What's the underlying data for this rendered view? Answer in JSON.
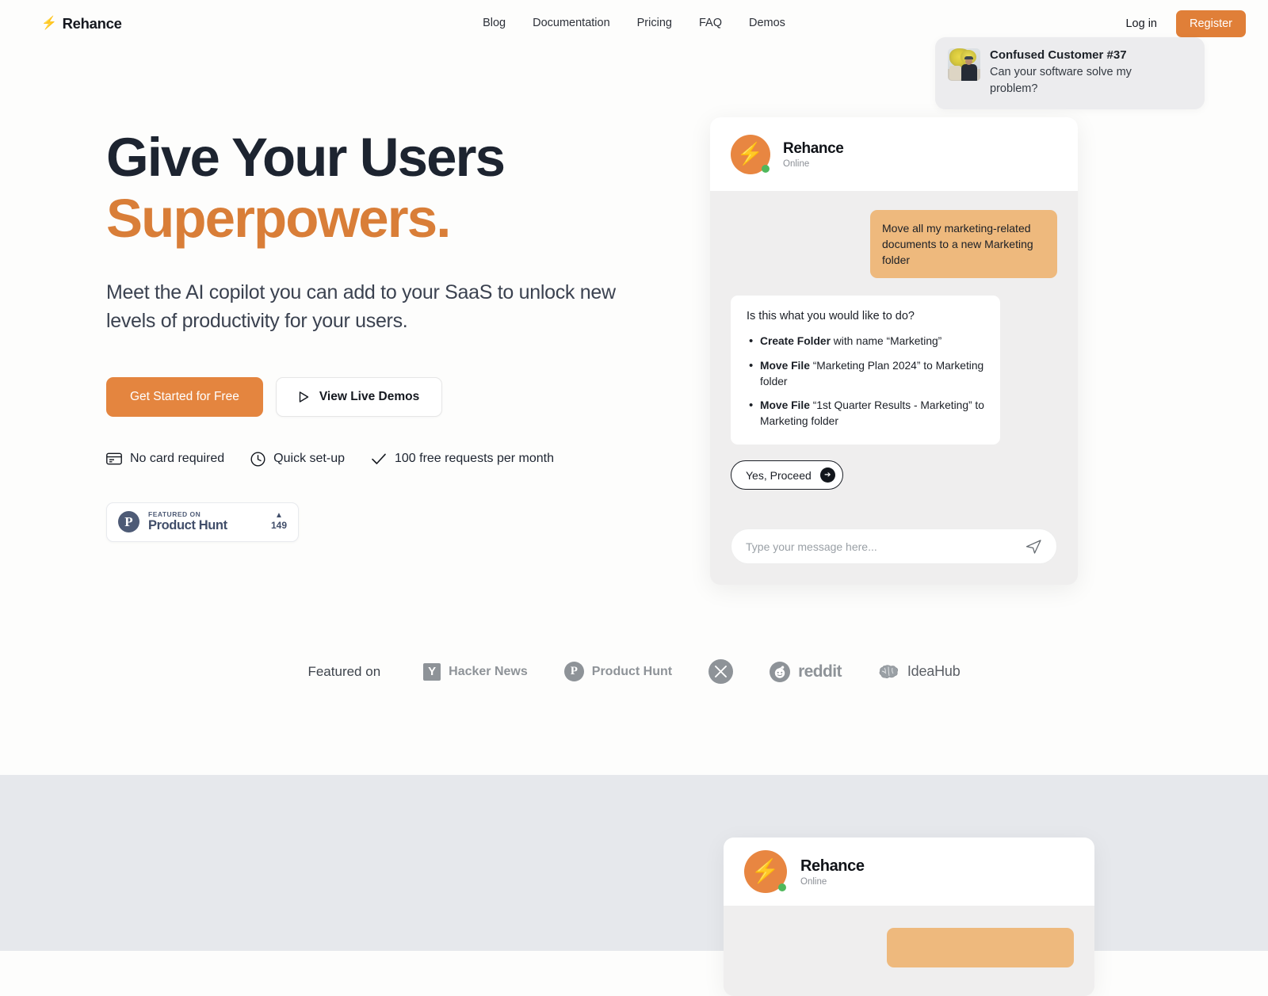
{
  "brand": {
    "name": "Rehance",
    "icon": "lightning-bolt-icon"
  },
  "nav": {
    "links": [
      {
        "label": "Blog"
      },
      {
        "label": "Documentation"
      },
      {
        "label": "Pricing"
      },
      {
        "label": "FAQ"
      },
      {
        "label": "Demos"
      }
    ],
    "login_label": "Log in",
    "register_label": "Register"
  },
  "toast": {
    "title": "Confused Customer #37",
    "message": "Can your software solve my problem?",
    "avatar_alt": "person-photo"
  },
  "hero": {
    "headline_line1": "Give Your Users",
    "headline_line2": "Superpowers.",
    "subhead": "Meet the AI copilot you can add to your SaaS to unlock new levels of productivity for your users.",
    "cta_primary": "Get Started for Free",
    "cta_secondary": "View Live Demos",
    "features": [
      {
        "icon": "credit-card-icon",
        "label": "No card required"
      },
      {
        "icon": "clock-icon",
        "label": "Quick set-up"
      },
      {
        "icon": "check-icon",
        "label": "100 free requests per month"
      }
    ],
    "product_hunt": {
      "featured_on": "FEATURED ON",
      "name": "Product Hunt",
      "votes": "149",
      "arrow": "▲",
      "logo_letter": "P"
    }
  },
  "chat": {
    "header": {
      "name": "Rehance",
      "status": "Online",
      "avatar_icon": "lightning-bolt-icon"
    },
    "user_message": "Move all my marketing-related documents to a new Marketing folder",
    "bot": {
      "question": "Is this what you would like to do?",
      "actions": [
        {
          "verb": "Create Folder",
          "rest": " with name “Marketing”"
        },
        {
          "verb": "Move File",
          "rest": " “Marketing Plan 2024” to Marketing folder"
        },
        {
          "verb": "Move File",
          "rest": " “1st Quarter Results - Marketing” to Marketing folder"
        }
      ],
      "proceed_label": "Yes, Proceed"
    },
    "input_placeholder": "Type your message here...",
    "send_icon": "send-paper-plane-icon"
  },
  "featured": {
    "label": "Featured on",
    "logos": [
      {
        "name": "Hacker News",
        "mark": "Y"
      },
      {
        "name": "Product Hunt",
        "mark": "P"
      },
      {
        "name": "",
        "mark": "X"
      },
      {
        "name": "reddit",
        "mark": "reddit-alien-icon"
      },
      {
        "name": "IdeaHub",
        "mark": "brain-icon"
      }
    ]
  },
  "chat_bottom": {
    "header": {
      "name": "Rehance",
      "status": "Online",
      "avatar_icon": "lightning-bolt-icon"
    }
  },
  "colors": {
    "accent_orange": "#e4853f",
    "headline_navy": "#1d2430",
    "bubble_orange": "#eeb97d",
    "online_green": "#4fb85c",
    "section_gray": "#e6e8ec",
    "product_hunt_navy": "#414e6a"
  }
}
